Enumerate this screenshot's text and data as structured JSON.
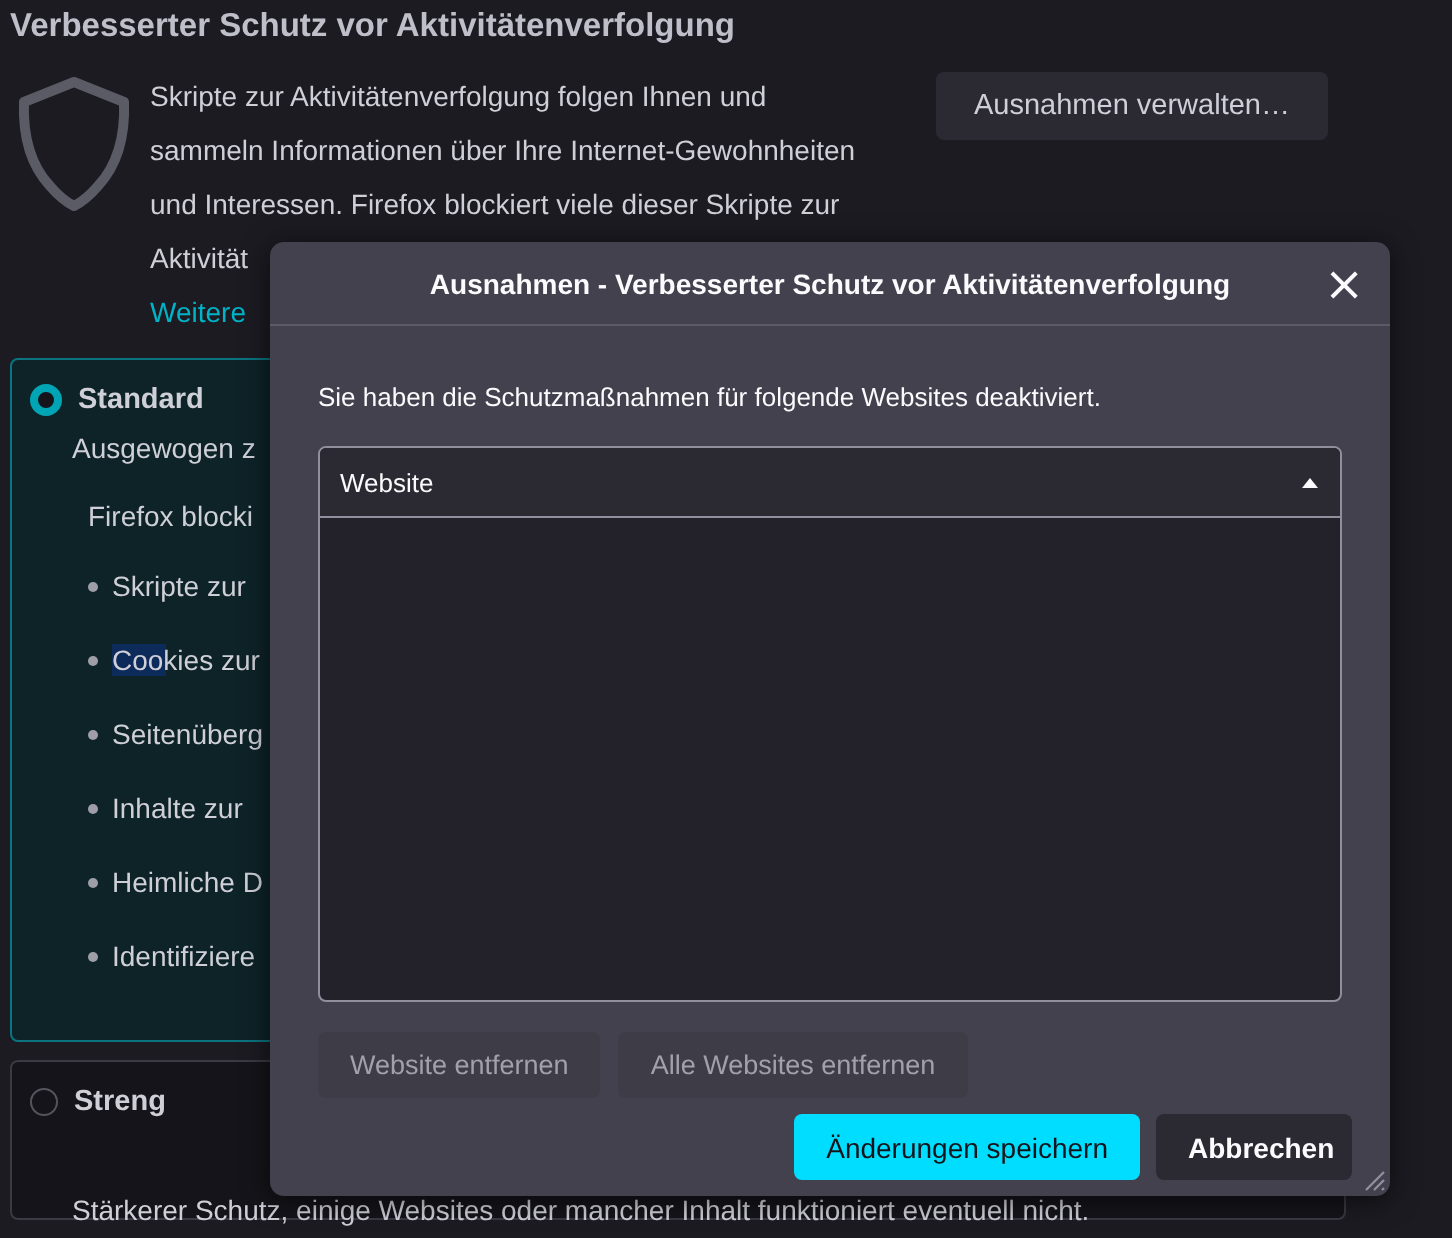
{
  "section": {
    "title": "Verbesserter Schutz vor Aktivitätenverfolgung",
    "description_lines": [
      "Skripte zur Aktivitätenverfolgung folgen Ihnen und",
      "sammeln Informationen über Ihre Internet-Gewohnheiten",
      "und Interessen. Firefox blockiert viele dieser Skripte zur",
      "Aktivität"
    ],
    "learn_more_link": "Weitere",
    "manage_button": "Ausnahmen verwalten…",
    "options": [
      {
        "label": "Standard",
        "selected": true,
        "summary": "Ausgewogen z",
        "details_intro": "Firefox blocki",
        "details": [
          "Skripte zur",
          "Cookies zur",
          "Seitenüberg",
          "Inhalte zur",
          "Heimliche D",
          "Identifiziere"
        ]
      },
      {
        "label": "Streng",
        "selected": false,
        "summary": "Stärkerer Schutz, einige Websites oder mancher Inhalt funktioniert eventuell nicht."
      }
    ]
  },
  "dialog": {
    "title": "Ausnahmen - Verbesserter Schutz vor Aktivitätenverfolgung",
    "close": "×",
    "description": "Sie haben die Schutzmaßnahmen für folgende Websites deaktiviert.",
    "table": {
      "columns": [
        {
          "label": "Website",
          "sorted_ascending": true
        }
      ]
    },
    "list_buttons": [
      {
        "label": "Website entfernen",
        "disabled": true
      },
      {
        "label": "Alle Websites entfernen",
        "disabled": true
      }
    ],
    "footer_buttons": [
      {
        "label": "Änderungen speichern",
        "kind": "primary"
      },
      {
        "label": "Abbrechen",
        "kind": "secondary"
      }
    ]
  }
}
